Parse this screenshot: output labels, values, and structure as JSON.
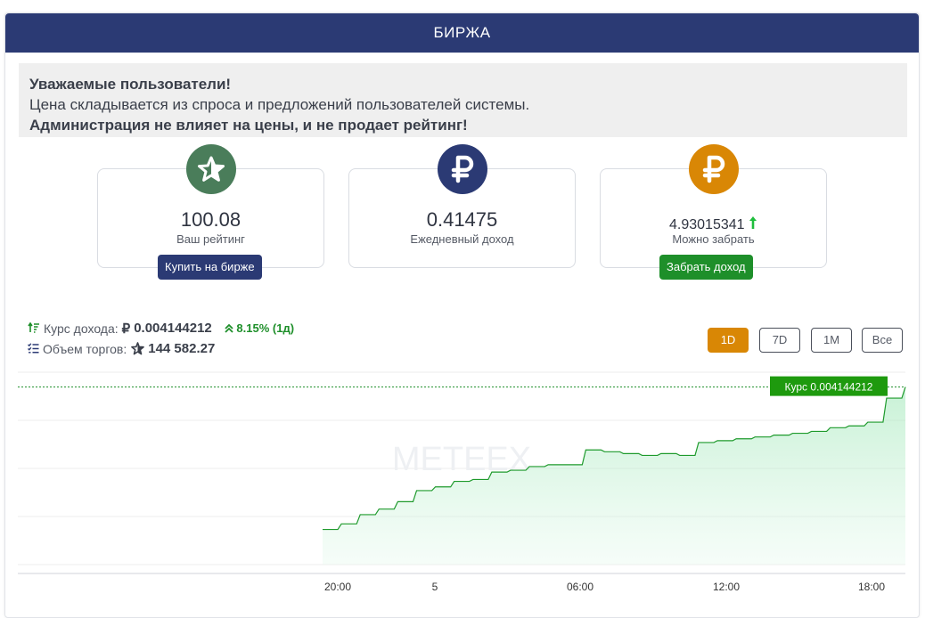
{
  "header": {
    "title": "БИРЖА"
  },
  "notice": {
    "line1": "Уважаемые пользователи!",
    "line2": "Цена складывается из спроса и предложений пользователей системы.",
    "line3": "Администрация не влияет на цены, и не продает рейтинг!"
  },
  "cards": {
    "rating": {
      "value": "100.08",
      "label": "Ваш рейтинг",
      "button": "Купить на бирже",
      "icon": "star-icon",
      "color": "#4a7d5a"
    },
    "daily": {
      "value": "0.41475",
      "label": "Ежедневный доход",
      "icon": "ruble-icon",
      "color": "#2b3a74"
    },
    "withdraw": {
      "value": "4.93015341",
      "label": "Можно забрать",
      "button": "Забрать доход",
      "icon": "ruble-icon",
      "color": "#d98705",
      "trend_icon": "arrow-up-icon"
    }
  },
  "stats": {
    "rate_label": "Курс дохода:",
    "rate_currency": "₽",
    "rate_value": "0.004144212",
    "rate_change": "8.15% (1д)",
    "volume_label": "Объем торгов:",
    "volume_value": "144 582.27"
  },
  "ranges": {
    "items": [
      "1D",
      "7D",
      "1M",
      "Все"
    ],
    "active": "1D"
  },
  "colors": {
    "accent_green": "#1e8f2a",
    "navy": "#2b3a74",
    "orange": "#d98705"
  },
  "chart_data": {
    "type": "area",
    "watermark": "METEEX",
    "current_label": "Курс 0.004144212",
    "x_tick_labels": [
      "20:00",
      "5",
      "06:00",
      "12:00",
      "18:00"
    ],
    "series": [
      {
        "values": [
          0.00364,
          0.00367,
          0.00372,
          0.00375,
          0.00379,
          0.00385,
          0.00387,
          0.0039,
          0.00391,
          0.00395,
          0.00396,
          0.00398,
          0.00399,
          0.00399,
          0.00407,
          0.00406,
          0.00405,
          0.00404,
          0.00405,
          0.00404,
          0.00411,
          0.00412,
          0.00413,
          0.00414,
          0.00415,
          0.00416,
          0.00417,
          0.00419,
          0.0042,
          0.00422,
          0.00435,
          0.00441
        ]
      }
    ]
  }
}
